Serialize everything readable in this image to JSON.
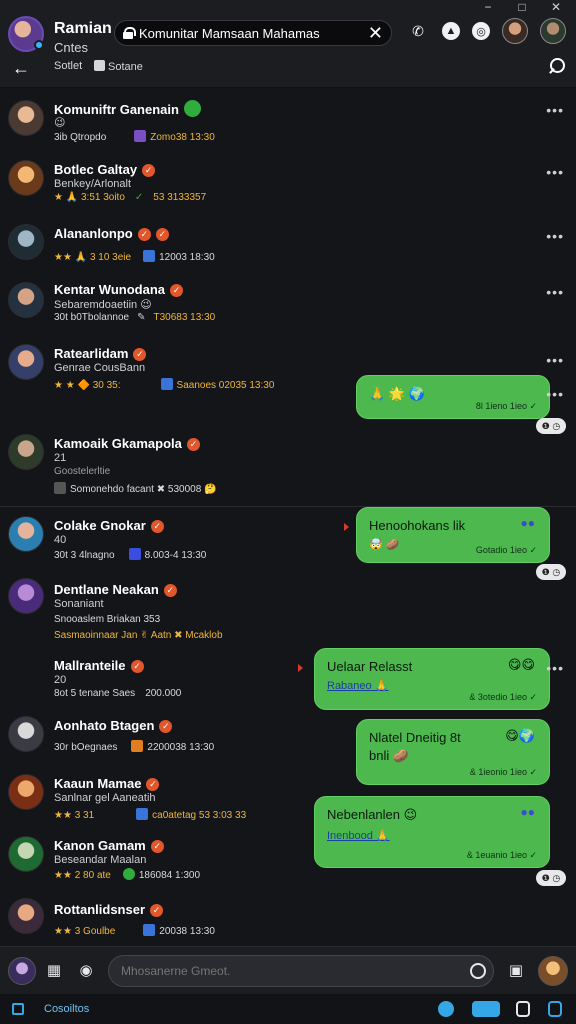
{
  "window": {
    "minimize": "−",
    "maximize": "□",
    "close": "✕"
  },
  "header": {
    "contact_name": "Ramian",
    "contact_status": "Cntes",
    "address": "Komunitar Mamsaan Mahamas",
    "clear_icon": "✕",
    "tabs": [
      {
        "label": "Sotlet"
      },
      {
        "label": "Sotane"
      }
    ],
    "icons": [
      "phone-icon",
      "bell-icon",
      "whatsapp-icon",
      "profile-avatar",
      "profile-avatar-2"
    ]
  },
  "chats": [
    {
      "name": "Komuniftr Ganenain",
      "line2": "😉",
      "line3": "3ib  Qtropdo",
      "tag": "Zomo38 13:30",
      "accent": "#a06ad8"
    },
    {
      "name": "Botlec Galtay",
      "line2": "Benkey/Arlonalt",
      "line3": "★ 🙏 3:51  3oito",
      "tag": "53 3133357",
      "accent": "#2fae3d"
    },
    {
      "name": "Alananlonpo",
      "line2": "",
      "line3": "★★ 🙏 3 10 3eie",
      "tag": "12003 18:30",
      "accent": "#3b74d9"
    },
    {
      "name": "Kentar Wunodana",
      "line2": "Sebaremdoaetiin 😉",
      "line3": "30t  b0Tbolannoe",
      "tag": "T30683 13:30",
      "accent": "#cfcfd2"
    },
    {
      "name": "Ratearlidam",
      "line2": "Genrae CousBann",
      "line3": "★ ★ 🔶 30 35:",
      "tag": "Saanoes  02035 13:30",
      "accent": "#3b74d9"
    },
    {
      "name": "Kamoaik Gkamapola",
      "line2": "21",
      "line3": "Goostelerltie",
      "tag": "Somonehdo facant  ✖ 530008 🤔",
      "accent": "#f0b63a"
    },
    {
      "name": "Colake Gnokar",
      "line2": "40",
      "line3": "30t  3 4lnagno",
      "tag": "8.003-4 13:30",
      "accent": "#3b4de0"
    },
    {
      "name": "Dentlane Neakan",
      "line2": "Sonaniant",
      "line3": "Snooaslem Briakan 353",
      "tag": "Sasmaoinnaar Jan ✌ Aatn ✖ Mcaklob",
      "accent": "#e2562b"
    },
    {
      "name": "Mallranteile",
      "line2": "20",
      "line3": "8ot 5 tenane   Saes",
      "tag": "200.000",
      "accent": "#cfcfd2"
    },
    {
      "name": "Aonhato Btagen",
      "line2": "30r bOegnaes",
      "line3": "",
      "tag": "2200038 13:30",
      "accent": "#e07f1f"
    },
    {
      "name": "Kaaun Mamae",
      "line2": "Sanlnar gel Aaneatih",
      "line3": "★★ 3 31",
      "tag": "ca0atetag  53 3:03 33",
      "accent": "#3b74d9"
    },
    {
      "name": "Kanon Gamam",
      "line2": "Beseandar Maalan",
      "line3": "★★ 2 80  ate",
      "tag": "186084 1:300",
      "accent": "#2fae3d"
    },
    {
      "name": "Rottanlidsnser",
      "line2": "",
      "line3": "★★ 3 Goulbe",
      "tag": "20038 13:30",
      "accent": "#3b74d9"
    }
  ],
  "bubbles": [
    {
      "text": "🙏 🌟 🌍",
      "meta": "8l 1ieno 1ieo ✓"
    },
    {
      "text": "Henoohokans lik",
      "extra": "🤯 🥔",
      "meta": "Gotadio 1ieo ✓"
    },
    {
      "text": "Uelaar Relasst",
      "link": "Rabaneo 🙏",
      "meta": "& 3otedio 1ieo ✓"
    },
    {
      "text": "Nlatel Dneitig 8t",
      "extra": "bnli 🥔",
      "meta": "& 1ieonio 1ieo ✓"
    },
    {
      "text": "Nebenlanlen 😉",
      "link": "Inenbood 🙏",
      "meta": "& 1euanio 1ieo ✓"
    }
  ],
  "reactions": [
    "❶ ◷",
    "❶ ◷",
    "❶ ◷"
  ],
  "composer": {
    "placeholder": "Mhosanerne Gmeot.",
    "value": ""
  },
  "statusbar": {
    "label": "Cosoiltos"
  },
  "colors": {
    "accent_green": "#4cb84e",
    "background": "#141518",
    "panel": "#1c1d21"
  }
}
